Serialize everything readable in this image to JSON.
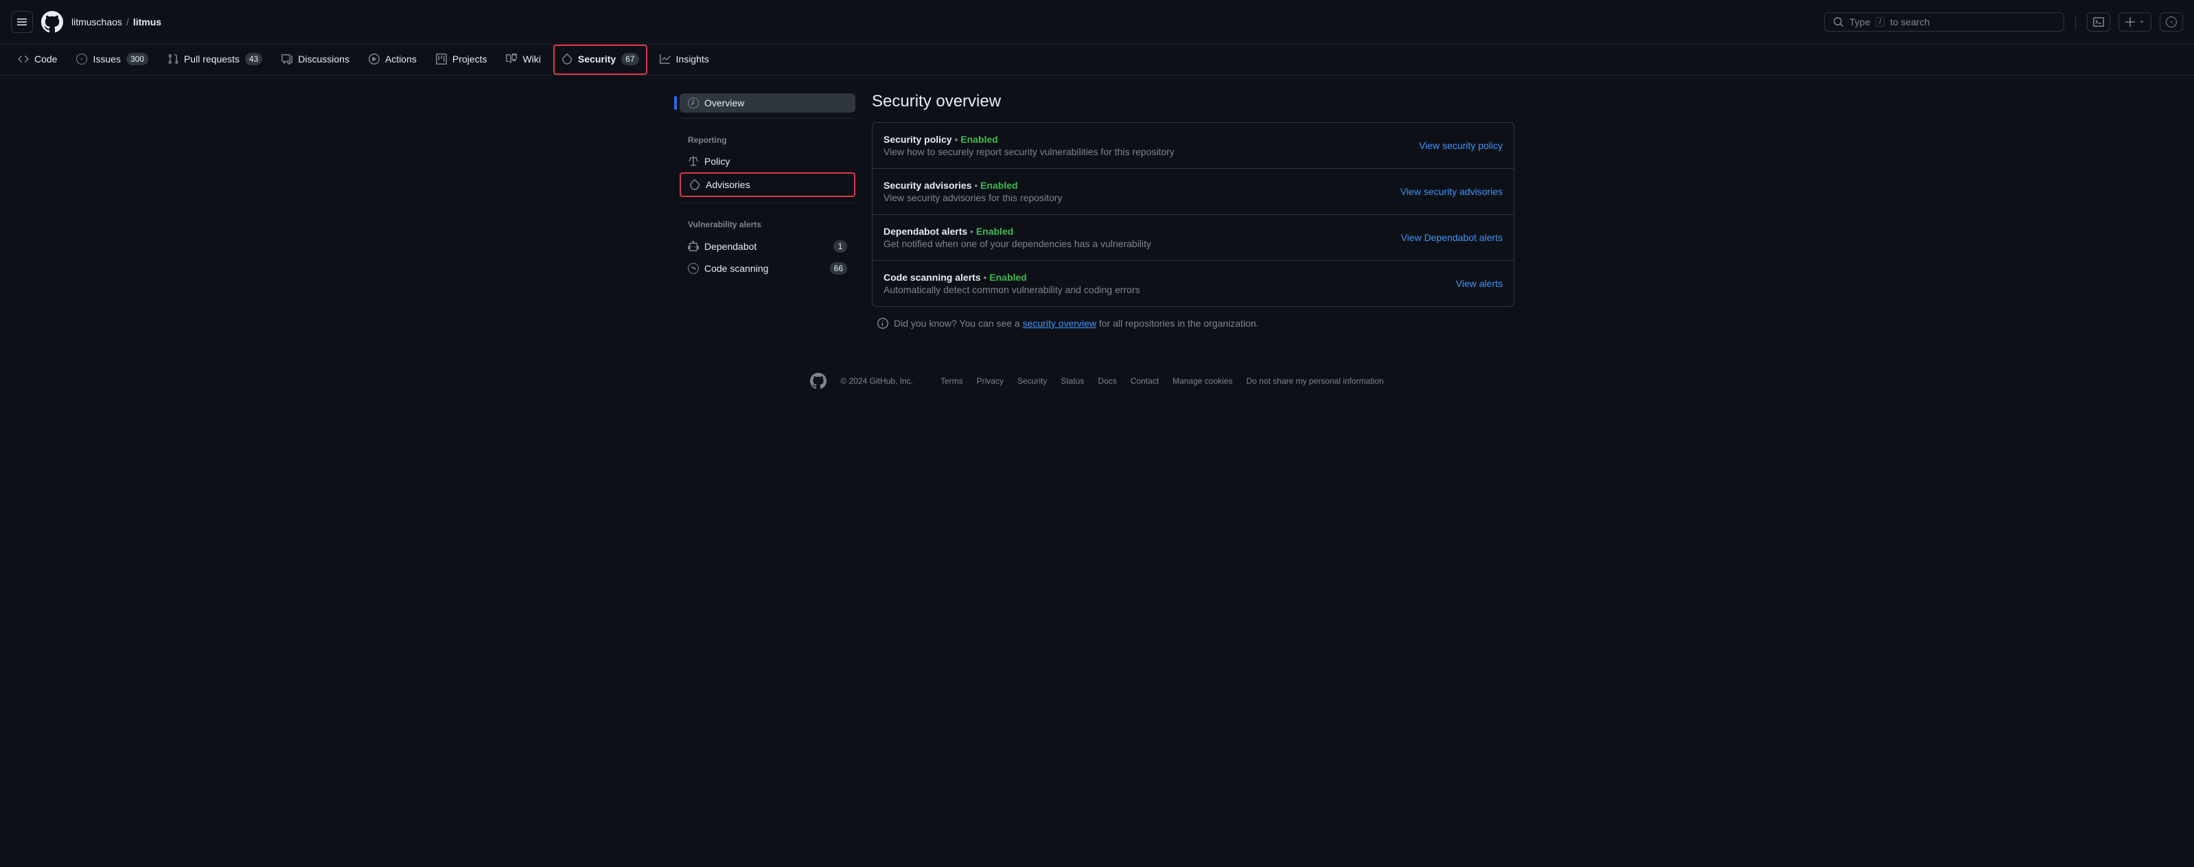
{
  "header": {
    "org": "litmuschaos",
    "sep": "/",
    "repo": "litmus",
    "search_prefix": "Type",
    "search_key": "/",
    "search_suffix": "to search"
  },
  "tabs": {
    "code": "Code",
    "issues": "Issues",
    "issues_count": "300",
    "pulls": "Pull requests",
    "pulls_count": "43",
    "discussions": "Discussions",
    "actions": "Actions",
    "projects": "Projects",
    "wiki": "Wiki",
    "security": "Security",
    "security_count": "67",
    "insights": "Insights"
  },
  "sidebar": {
    "overview": "Overview",
    "reporting_header": "Reporting",
    "policy": "Policy",
    "advisories": "Advisories",
    "vuln_header": "Vulnerability alerts",
    "dependabot": "Dependabot",
    "dependabot_count": "1",
    "codescan": "Code scanning",
    "codescan_count": "66"
  },
  "page": {
    "title": "Security overview",
    "info_prefix": "Did you know? You can see a ",
    "info_link": "security overview",
    "info_suffix": " for all repositories in the organization."
  },
  "cards": [
    {
      "title": "Security policy",
      "status": "Enabled",
      "desc": "View how to securely report security vulnerabilities for this repository",
      "link": "View security policy"
    },
    {
      "title": "Security advisories",
      "status": "Enabled",
      "desc": "View security advisories for this repository",
      "link": "View security advisories"
    },
    {
      "title": "Dependabot alerts",
      "status": "Enabled",
      "desc": "Get notified when one of your dependencies has a vulnerability",
      "link": "View Dependabot alerts"
    },
    {
      "title": "Code scanning alerts",
      "status": "Enabled",
      "desc": "Automatically detect common vulnerability and coding errors",
      "link": "View alerts"
    }
  ],
  "footer": {
    "copyright": "© 2024 GitHub, Inc.",
    "links": [
      "Terms",
      "Privacy",
      "Security",
      "Status",
      "Docs",
      "Contact",
      "Manage cookies",
      "Do not share my personal information"
    ]
  }
}
